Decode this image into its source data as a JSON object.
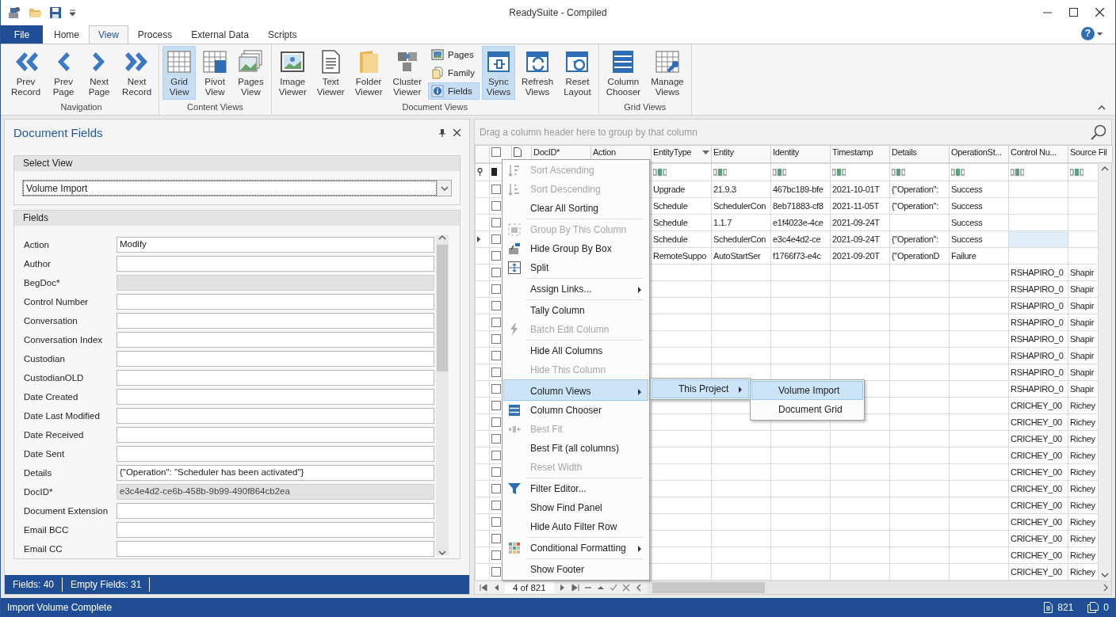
{
  "title_bar": {
    "title": "ReadySuite - Compiled"
  },
  "ribbon_tabs": [
    {
      "label": "File",
      "kind": "file",
      "selected": false
    },
    {
      "label": "Home",
      "kind": "tab",
      "selected": false
    },
    {
      "label": "View",
      "kind": "tab",
      "selected": true
    },
    {
      "label": "Process",
      "kind": "tab",
      "selected": false
    },
    {
      "label": "External Data",
      "kind": "tab",
      "selected": false
    },
    {
      "label": "Scripts",
      "kind": "tab",
      "selected": false
    }
  ],
  "help": "?",
  "ribbon_groups": [
    {
      "label": "Navigation",
      "buttons": [
        {
          "label": "Prev Record",
          "kind": "large",
          "selected": false
        },
        {
          "label": "Prev Page",
          "kind": "large",
          "selected": false
        },
        {
          "label": "Next Page",
          "kind": "large",
          "selected": false
        },
        {
          "label": "Next Record",
          "kind": "large",
          "selected": false
        }
      ]
    },
    {
      "label": "Content Views",
      "buttons": [
        {
          "label": "Grid View",
          "kind": "large",
          "selected": true
        },
        {
          "label": "Pivot View",
          "kind": "large",
          "selected": false
        },
        {
          "label": "Pages View",
          "kind": "large",
          "selected": false
        }
      ]
    },
    {
      "label": "Document Views",
      "buttons": [
        {
          "label": "Image Viewer",
          "kind": "large",
          "selected": false
        },
        {
          "label": "Text Viewer",
          "kind": "large",
          "selected": false
        },
        {
          "label": "Folder Viewer",
          "kind": "large",
          "selected": false
        },
        {
          "label": "Cluster Viewer",
          "kind": "large",
          "selected": false
        },
        {
          "label": "Pages",
          "kind": "small",
          "selected": false
        },
        {
          "label": "Family",
          "kind": "small",
          "selected": false
        },
        {
          "label": "Fields",
          "kind": "small",
          "selected": true
        },
        {
          "label": "Sync Views",
          "kind": "large",
          "selected": true
        },
        {
          "label": "Refresh Views",
          "kind": "large",
          "selected": false
        },
        {
          "label": "Reset Layout",
          "kind": "large",
          "selected": false
        }
      ]
    },
    {
      "label": "Grid Views",
      "buttons": [
        {
          "label": "Column Chooser",
          "kind": "large",
          "selected": false
        },
        {
          "label": "Manage Views",
          "kind": "large",
          "selected": false
        }
      ]
    }
  ],
  "document_fields": {
    "title": "Document Fields",
    "select_view": {
      "label": "Select View",
      "value": "Volume Import"
    },
    "fields_group": {
      "label": "Fields",
      "fields": [
        {
          "label": "Action",
          "value": "Modify",
          "disabled": false
        },
        {
          "label": "Author",
          "disabled": false
        },
        {
          "label": "BegDoc*",
          "disabled": true
        },
        {
          "label": "Control Number",
          "disabled": false
        },
        {
          "label": "Conversation",
          "disabled": false
        },
        {
          "label": "Conversation Index",
          "disabled": false
        },
        {
          "label": "Custodian",
          "disabled": false
        },
        {
          "label": "CustodianOLD",
          "disabled": false
        },
        {
          "label": "Date Created",
          "disabled": false
        },
        {
          "label": "Date Last Modified",
          "disabled": false
        },
        {
          "label": "Date Received",
          "disabled": false
        },
        {
          "label": "Date Sent",
          "disabled": false
        },
        {
          "label": "Details",
          "value": "{\"Operation\": \"Scheduler has been activated\"}",
          "disabled": false
        },
        {
          "label": "DocID*",
          "value": "e3c4e4d2-ce6b-458b-9b99-490f864cb2ea",
          "disabled": true
        },
        {
          "label": "Document Extension",
          "disabled": false
        },
        {
          "label": "Email BCC",
          "disabled": false
        },
        {
          "label": "Email CC",
          "disabled": false
        }
      ]
    },
    "footer": [
      "Fields: 40",
      "Empty Fields: 31"
    ]
  },
  "grid": {
    "group_panel_placeholder": "Drag a column header here to group by that column",
    "columns": [
      {
        "label": "DocID*",
        "dropdown": false
      },
      {
        "label": "Action",
        "dropdown": false
      },
      {
        "label": "EntityType",
        "dropdown": true
      },
      {
        "label": "Entity",
        "dropdown": false
      },
      {
        "label": "Identity",
        "dropdown": false
      },
      {
        "label": "Timestamp",
        "dropdown": false
      },
      {
        "label": "Details",
        "dropdown": false
      },
      {
        "label": "OperationSt...",
        "dropdown": false
      },
      {
        "label": "Control Nu...",
        "dropdown": false
      },
      {
        "label": "Source Fil",
        "dropdown": false
      }
    ],
    "header_checkbox": {
      "checked": false
    },
    "rows": [
      {
        "selected": false,
        "checked": false,
        "cells": [
          null,
          null,
          "Upgrade",
          "21.9.3",
          "467bc189-bfe",
          "2021-10-01T",
          "{\"Operation\":",
          "Success",
          null,
          null
        ]
      },
      {
        "selected": false,
        "checked": false,
        "cells": [
          null,
          null,
          "Schedule",
          "SchedulerCon",
          "8eb71883-cf8",
          "2021-11-05T",
          "{\"Operation\":",
          "Success",
          null,
          null
        ]
      },
      {
        "selected": false,
        "checked": false,
        "cells": [
          null,
          null,
          "Schedule",
          "1.1.7",
          "e1f4023e-4ce",
          "2021-09-24T",
          null,
          "Success",
          null,
          null
        ]
      },
      {
        "selected": true,
        "checked": false,
        "cells": [
          null,
          null,
          "Schedule",
          "SchedulerCon",
          "e3c4e4d2-ce",
          "2021-09-24T",
          "{\"Operation\":",
          "Success",
          null,
          null
        ]
      },
      {
        "selected": false,
        "checked": false,
        "cells": [
          null,
          null,
          "RemoteSuppo",
          "AutoStartSer",
          "f1766f73-e4c",
          "2021-09-20T",
          "{\"OperationD",
          "Failure",
          null,
          null
        ]
      },
      {
        "selected": false,
        "checked": false,
        "cells": [
          null,
          null,
          null,
          null,
          null,
          null,
          null,
          null,
          "RSHAPIRO_0",
          "Shapir"
        ]
      },
      {
        "selected": false,
        "checked": false,
        "cells": [
          null,
          null,
          null,
          null,
          null,
          null,
          null,
          null,
          "RSHAPIRO_0",
          "Shapir"
        ]
      },
      {
        "selected": false,
        "checked": false,
        "cells": [
          null,
          null,
          null,
          null,
          null,
          null,
          null,
          null,
          "RSHAPIRO_0",
          "Shapir"
        ]
      },
      {
        "selected": false,
        "checked": false,
        "cells": [
          null,
          null,
          null,
          null,
          null,
          null,
          null,
          null,
          "RSHAPIRO_0",
          "Shapir"
        ]
      },
      {
        "selected": false,
        "checked": false,
        "cells": [
          null,
          null,
          null,
          null,
          null,
          null,
          null,
          null,
          "RSHAPIRO_0",
          "Shapir"
        ]
      },
      {
        "selected": false,
        "checked": false,
        "cells": [
          null,
          null,
          null,
          null,
          null,
          null,
          null,
          null,
          "RSHAPIRO_0",
          "Shapir"
        ]
      },
      {
        "selected": false,
        "checked": false,
        "cells": [
          null,
          null,
          null,
          null,
          null,
          null,
          null,
          null,
          "RSHAPIRO_0",
          "Shapir"
        ]
      },
      {
        "selected": false,
        "checked": false,
        "cells": [
          null,
          null,
          null,
          null,
          null,
          null,
          null,
          null,
          "RSHAPIRO_0",
          "Shapir"
        ]
      },
      {
        "selected": false,
        "checked": false,
        "cells": [
          null,
          null,
          null,
          null,
          null,
          null,
          null,
          null,
          "CRICHEY_00",
          "Richey"
        ]
      },
      {
        "selected": false,
        "checked": false,
        "cells": [
          null,
          null,
          null,
          null,
          null,
          null,
          null,
          null,
          "CRICHEY_00",
          "Richey"
        ]
      },
      {
        "selected": false,
        "checked": false,
        "cells": [
          null,
          null,
          null,
          null,
          null,
          null,
          null,
          null,
          "CRICHEY_00",
          "Richey"
        ]
      },
      {
        "selected": false,
        "checked": false,
        "cells": [
          null,
          null,
          null,
          null,
          null,
          null,
          null,
          null,
          "CRICHEY_00",
          "Richey"
        ]
      },
      {
        "selected": false,
        "checked": false,
        "cells": [
          null,
          null,
          null,
          null,
          null,
          null,
          null,
          null,
          "CRICHEY_00",
          "Richey"
        ]
      },
      {
        "selected": false,
        "checked": false,
        "cells": [
          null,
          null,
          null,
          null,
          null,
          null,
          null,
          null,
          "CRICHEY_00",
          "Richey"
        ]
      },
      {
        "selected": false,
        "checked": false,
        "cells": [
          null,
          null,
          null,
          null,
          null,
          null,
          null,
          null,
          "CRICHEY_00",
          "Richey"
        ]
      },
      {
        "selected": false,
        "checked": false,
        "cells": [
          null,
          null,
          null,
          null,
          null,
          null,
          null,
          null,
          "CRICHEY_00",
          "Richey"
        ]
      },
      {
        "selected": false,
        "checked": false,
        "cells": [
          null,
          null,
          null,
          null,
          null,
          null,
          null,
          null,
          "CRICHEY_00",
          "Richey"
        ]
      },
      {
        "selected": false,
        "checked": false,
        "cells": [
          null,
          null,
          null,
          null,
          null,
          null,
          null,
          null,
          "CRICHEY_00",
          "Richey"
        ]
      },
      {
        "selected": false,
        "checked": false,
        "cells": [
          null,
          null,
          null,
          null,
          null,
          null,
          null,
          null,
          "CRICHEY_00",
          "Richey"
        ]
      }
    ],
    "navigator": {
      "position": "4 of 821"
    }
  },
  "context_menu": {
    "items": [
      {
        "label": "Sort Ascending",
        "disabled": true,
        "submenu": false,
        "separator_before": false,
        "selected": false
      },
      {
        "label": "Sort Descending",
        "disabled": true,
        "submenu": false,
        "separator_before": false,
        "selected": false
      },
      {
        "label": "Clear All Sorting",
        "disabled": false,
        "submenu": false,
        "separator_before": false,
        "selected": false
      },
      {
        "label": "Group By This Column",
        "disabled": true,
        "submenu": false,
        "separator_before": true,
        "selected": false
      },
      {
        "label": "Hide Group By Box",
        "disabled": false,
        "submenu": false,
        "separator_before": false,
        "selected": false
      },
      {
        "label": "Split",
        "disabled": false,
        "submenu": false,
        "separator_before": false,
        "selected": false
      },
      {
        "label": "Assign Links...",
        "disabled": false,
        "submenu": true,
        "separator_before": true,
        "selected": false
      },
      {
        "label": "Tally Column",
        "disabled": false,
        "submenu": false,
        "separator_before": true,
        "selected": false
      },
      {
        "label": "Batch Edit Column",
        "disabled": true,
        "submenu": false,
        "separator_before": false,
        "selected": false
      },
      {
        "label": "Hide All Columns",
        "disabled": false,
        "submenu": false,
        "separator_before": true,
        "selected": false
      },
      {
        "label": "Hide This Column",
        "disabled": true,
        "submenu": false,
        "separator_before": false,
        "selected": false
      },
      {
        "label": "Column Views",
        "disabled": false,
        "submenu": true,
        "separator_before": true,
        "selected": true
      },
      {
        "label": "Column Chooser",
        "disabled": false,
        "submenu": false,
        "separator_before": false,
        "selected": false
      },
      {
        "label": "Best Fit",
        "disabled": true,
        "submenu": false,
        "separator_before": false,
        "selected": false
      },
      {
        "label": "Best Fit (all columns)",
        "disabled": false,
        "submenu": false,
        "separator_before": false,
        "selected": false
      },
      {
        "label": "Reset Width",
        "disabled": true,
        "submenu": false,
        "separator_before": false,
        "selected": false
      },
      {
        "label": "Filter Editor...",
        "disabled": false,
        "submenu": false,
        "separator_before": true,
        "selected": false
      },
      {
        "label": "Show Find Panel",
        "disabled": false,
        "submenu": false,
        "separator_before": false,
        "selected": false
      },
      {
        "label": "Hide Auto Filter Row",
        "disabled": false,
        "submenu": false,
        "separator_before": false,
        "selected": false
      },
      {
        "label": "Conditional Formatting",
        "disabled": false,
        "submenu": true,
        "separator_before": true,
        "selected": false
      },
      {
        "label": "Show Footer",
        "disabled": false,
        "submenu": false,
        "separator_before": true,
        "selected": false
      }
    ]
  },
  "column_views_submenu": {
    "items": [
      {
        "label": "This Project",
        "submenu": true,
        "selected": true
      }
    ]
  },
  "this_project_submenu": {
    "items": [
      {
        "label": "Volume Import",
        "selected": true
      },
      {
        "label": "Document Grid",
        "selected": false
      }
    ]
  },
  "status_bar": {
    "message": "Import Volume Complete",
    "document_count": "821",
    "page_count": "0"
  }
}
